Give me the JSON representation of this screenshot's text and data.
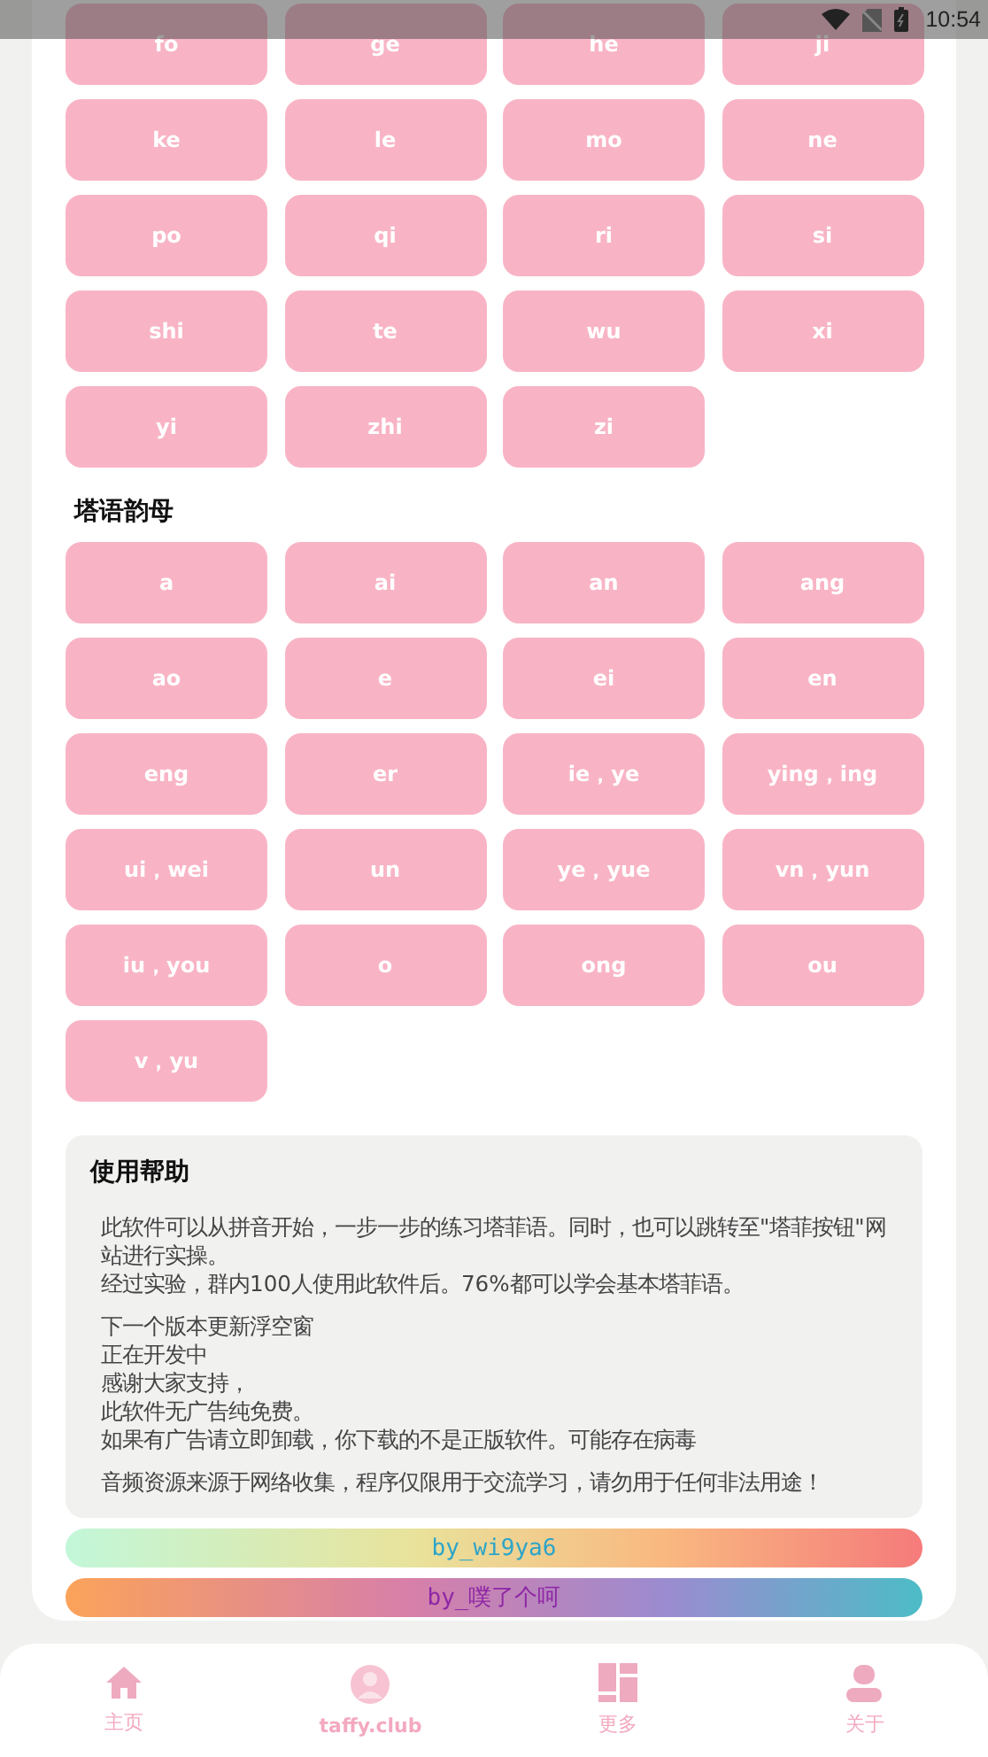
{
  "status_bar": {
    "time": "10:54"
  },
  "sections": [
    {
      "buttons": [
        "fo",
        "ge",
        "he",
        "ji",
        "ke",
        "le",
        "mo",
        "ne",
        "po",
        "qi",
        "ri",
        "si",
        "shi",
        "te",
        "wu",
        "xi",
        "yi",
        "zhi",
        "zi"
      ]
    },
    {
      "title": "塔语韵母",
      "buttons": [
        "a",
        "ai",
        "an",
        "ang",
        "ao",
        "e",
        "ei",
        "en",
        "eng",
        "er",
        "ie，ye",
        "ying，ing",
        "ui，wei",
        "un",
        "ye，yue",
        "vn，yun",
        "iu，you",
        "o",
        "ong",
        "ou",
        "v，yu"
      ]
    }
  ],
  "help": {
    "title": "使用帮助",
    "paragraphs": [
      [
        "此软件可以从拼音开始，一步一步的练习塔菲语。同时，也可以跳转至\"塔菲按钮\"网站进行实操。",
        "经过实验，群内100人使用此软件后。76%都可以学会基本塔菲语。"
      ],
      [
        "下一个版本更新浮空窗",
        "正在开发中",
        "感谢大家支持，",
        "此软件无广告纯免费。",
        "如果有广告请立即卸载，你下载的不是正版软件。可能存在病毒"
      ],
      [
        "音频资源来源于网络收集，程序仅限用于交流学习，请勿用于任何非法用途！"
      ]
    ]
  },
  "credits": [
    {
      "text": "by_wi9ya6"
    },
    {
      "text": "by_噗了个呵"
    }
  ],
  "nav": [
    {
      "label": "主页"
    },
    {
      "label": "taffy.club"
    },
    {
      "label": "更多"
    },
    {
      "label": "关于"
    }
  ]
}
